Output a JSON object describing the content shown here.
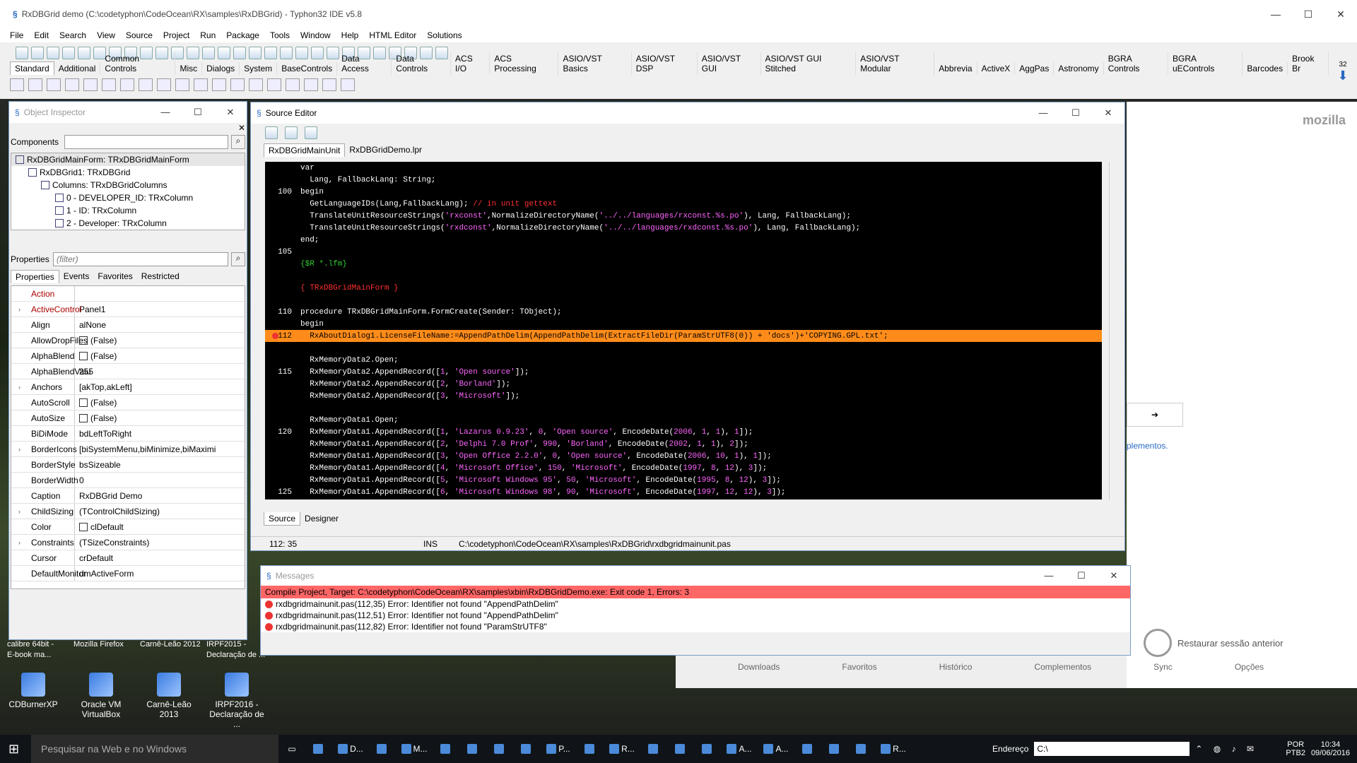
{
  "ide": {
    "title": "RxDBGrid demo (C:\\codetyphon\\CodeOcean\\RX\\samples\\RxDBGrid) - Typhon32 IDE v5.8",
    "menu": [
      "File",
      "Edit",
      "Search",
      "View",
      "Source",
      "Project",
      "Run",
      "Package",
      "Tools",
      "Window",
      "Help",
      "HTML Editor",
      "Solutions"
    ],
    "palette_tabs": [
      "Standard",
      "Additional",
      "Common Controls",
      "Misc",
      "Dialogs",
      "System",
      "BaseControls",
      "Data Access",
      "Data Controls",
      "ACS I/O",
      "ACS Processing",
      "ASIO/VST Basics",
      "ASIO/VST DSP",
      "ASIO/VST GUI",
      "ASIO/VST GUI Stitched",
      "ASIO/VST Modular",
      "Abbrevia",
      "ActiveX",
      "AggPas",
      "Astronomy",
      "BGRA Controls",
      "BGRA uEControls",
      "Barcodes",
      "Brook Br"
    ],
    "palette_count": "32"
  },
  "object_inspector": {
    "title": "Object Inspector",
    "components_label": "Components",
    "tree": [
      "RxDBGridMainForm: TRxDBGridMainForm",
      "RxDBGrid1: TRxDBGrid",
      "Columns: TRxDBGridColumns",
      "0 - DEVELOPER_ID: TRxColumn",
      "1 - ID: TRxColumn",
      "2 - Developer: TRxColumn"
    ],
    "properties_label": "Properties",
    "filter_placeholder": "(filter)",
    "tabs": [
      "Properties",
      "Events",
      "Favorites",
      "Restricted"
    ],
    "props": [
      {
        "name": "Action",
        "value": "",
        "red": true,
        "exp": false,
        "cb": false
      },
      {
        "name": "ActiveControl",
        "value": "Panel1",
        "red": true,
        "exp": true,
        "cb": false
      },
      {
        "name": "Align",
        "value": "alNone",
        "red": false,
        "exp": false,
        "cb": false
      },
      {
        "name": "AllowDropFiles",
        "value": "(False)",
        "red": false,
        "exp": false,
        "cb": true
      },
      {
        "name": "AlphaBlend",
        "value": "(False)",
        "red": false,
        "exp": false,
        "cb": true
      },
      {
        "name": "AlphaBlendValu",
        "value": "255",
        "red": false,
        "exp": false,
        "cb": false
      },
      {
        "name": "Anchors",
        "value": "[akTop,akLeft]",
        "red": false,
        "exp": true,
        "cb": false
      },
      {
        "name": "AutoScroll",
        "value": "(False)",
        "red": false,
        "exp": false,
        "cb": true
      },
      {
        "name": "AutoSize",
        "value": "(False)",
        "red": false,
        "exp": false,
        "cb": true
      },
      {
        "name": "BiDiMode",
        "value": "bdLeftToRight",
        "red": false,
        "exp": false,
        "cb": false
      },
      {
        "name": "BorderIcons",
        "value": "[biSystemMenu,biMinimize,biMaximi",
        "red": false,
        "exp": true,
        "cb": false
      },
      {
        "name": "BorderStyle",
        "value": "bsSizeable",
        "red": false,
        "exp": false,
        "cb": false
      },
      {
        "name": "BorderWidth",
        "value": "0",
        "red": false,
        "exp": false,
        "cb": false
      },
      {
        "name": "Caption",
        "value": "RxDBGrid Demo",
        "red": false,
        "exp": false,
        "cb": false
      },
      {
        "name": "ChildSizing",
        "value": "(TControlChildSizing)",
        "red": false,
        "exp": true,
        "cb": false
      },
      {
        "name": "Color",
        "value": "clDefault",
        "red": false,
        "exp": false,
        "cb": true
      },
      {
        "name": "Constraints",
        "value": "(TSizeConstraints)",
        "red": false,
        "exp": true,
        "cb": false
      },
      {
        "name": "Cursor",
        "value": "crDefault",
        "red": false,
        "exp": false,
        "cb": false
      },
      {
        "name": "DefaultMonitor",
        "value": "dmActiveForm",
        "red": false,
        "exp": false,
        "cb": false
      }
    ]
  },
  "source_editor": {
    "title": "Source Editor",
    "tabs": [
      "RxDBGridMainUnit",
      "RxDBGridDemo.lpr"
    ],
    "bottom_tabs": [
      "Source",
      "Designer"
    ],
    "status_pos": "112: 35",
    "status_mode": "INS",
    "status_file": "C:\\codetyphon\\CodeOcean\\RX\\samples\\RxDBGrid\\rxdbgridmainunit.pas",
    "lines": [
      {
        "n": "",
        "t": "var"
      },
      {
        "n": "",
        "t": "  Lang, FallbackLang: String;"
      },
      {
        "n": "100",
        "t": "begin"
      },
      {
        "n": "",
        "t": "  GetLanguageIDs(Lang,FallbackLang); // in unit gettext"
      },
      {
        "n": "",
        "t": "  TranslateUnitResourceStrings('rxconst',NormalizeDirectoryName('../../languages/rxconst.%s.po'), Lang, FallbackLang);"
      },
      {
        "n": "",
        "t": "  TranslateUnitResourceStrings('rxdconst',NormalizeDirectoryName('../../languages/rxdconst.%s.po'), Lang, FallbackLang);"
      },
      {
        "n": "",
        "t": "end;"
      },
      {
        "n": "105",
        "t": ""
      },
      {
        "n": "",
        "t": "{$R *.lfm}"
      },
      {
        "n": "",
        "t": ""
      },
      {
        "n": "",
        "t": "{ TRxDBGridMainForm }"
      },
      {
        "n": "",
        "t": ""
      },
      {
        "n": "110",
        "t": "procedure TRxDBGridMainForm.FormCreate(Sender: TObject);"
      },
      {
        "n": "",
        "t": "begin"
      },
      {
        "n": "112",
        "t": "  RxAboutDialog1.LicenseFileName:=AppendPathDelim(AppendPathDelim(ExtractFileDir(ParamStrUTF8(0)) + 'docs')+'COPYING.GPL.txt';",
        "hl": true
      },
      {
        "n": "",
        "t": ""
      },
      {
        "n": "",
        "t": "  RxMemoryData2.Open;"
      },
      {
        "n": "115",
        "t": "  RxMemoryData2.AppendRecord([1, 'Open source']);"
      },
      {
        "n": "",
        "t": "  RxMemoryData2.AppendRecord([2, 'Borland']);"
      },
      {
        "n": "",
        "t": "  RxMemoryData2.AppendRecord([3, 'Microsoft']);"
      },
      {
        "n": "",
        "t": ""
      },
      {
        "n": "",
        "t": "  RxMemoryData1.Open;"
      },
      {
        "n": "120",
        "t": "  RxMemoryData1.AppendRecord([1, 'Lazarus 0.9.23', 0, 'Open source', EncodeDate(2006, 1, 1), 1]);"
      },
      {
        "n": "",
        "t": "  RxMemoryData1.AppendRecord([2, 'Delphi 7.0 Prof', 990, 'Borland', EncodeDate(2002, 1, 1), 2]);"
      },
      {
        "n": "",
        "t": "  RxMemoryData1.AppendRecord([3, 'Open Office 2.2.0', 0, 'Open source', EncodeDate(2006, 10, 1), 1]);"
      },
      {
        "n": "",
        "t": "  RxMemoryData1.AppendRecord([4, 'Microsoft Office', 150, 'Microsoft', EncodeDate(1997, 8, 12), 3]);"
      },
      {
        "n": "",
        "t": "  RxMemoryData1.AppendRecord([5, 'Microsoft Windows 95', 50, 'Microsoft', EncodeDate(1995, 8, 12), 3]);"
      },
      {
        "n": "125",
        "t": "  RxMemoryData1.AppendRecord([6, 'Microsoft Windows 98', 90, 'Microsoft', EncodeDate(1997, 12, 12), 3]);"
      }
    ]
  },
  "messages": {
    "title": "Messages",
    "header": "Compile Project, Target: C:\\codetyphon\\CodeOcean\\RX\\samples\\xbin\\RxDBGridDemo.exe: Exit code 1, Errors: 3",
    "items": [
      "rxdbgridmainunit.pas(112,35) Error: Identifier not found \"AppendPathDelim\"",
      "rxdbgridmainunit.pas(112,51) Error: Identifier not found \"AppendPathDelim\"",
      "rxdbgridmainunit.pas(112,82) Error: Identifier not found \"ParamStrUTF8\""
    ]
  },
  "firefox": {
    "brand": "mozilla",
    "complements_link": "plementos.",
    "restore": "Restaurar sessão anterior",
    "footer": [
      "Downloads",
      "Favoritos",
      "Histórico",
      "Complementos",
      "Sync",
      "Opções"
    ]
  },
  "desktop": {
    "top_labels": [
      "calibre 64bit -",
      "E-book ma...",
      "Mozilla Firefox",
      "Carnê-Leão 2012",
      "IRPF2015 -",
      "Declaração de ..."
    ],
    "icons": [
      {
        "label": "CDBurnerXP"
      },
      {
        "label": "Oracle VM VirtualBox"
      },
      {
        "label": "Carnê-Leão 2013"
      },
      {
        "label": "IRPF2016 - Declaração de ..."
      }
    ]
  },
  "taskbar": {
    "search_placeholder": "Pesquisar na Web e no Windows",
    "apps": [
      "D...",
      "M...",
      "P...",
      "R...",
      "A...",
      "A...",
      "R..."
    ],
    "address_label": "Endereço",
    "address_value": "C:\\",
    "lang": "POR",
    "lang2": "PTB2",
    "time": "10:34",
    "date": "09/06/2016"
  }
}
